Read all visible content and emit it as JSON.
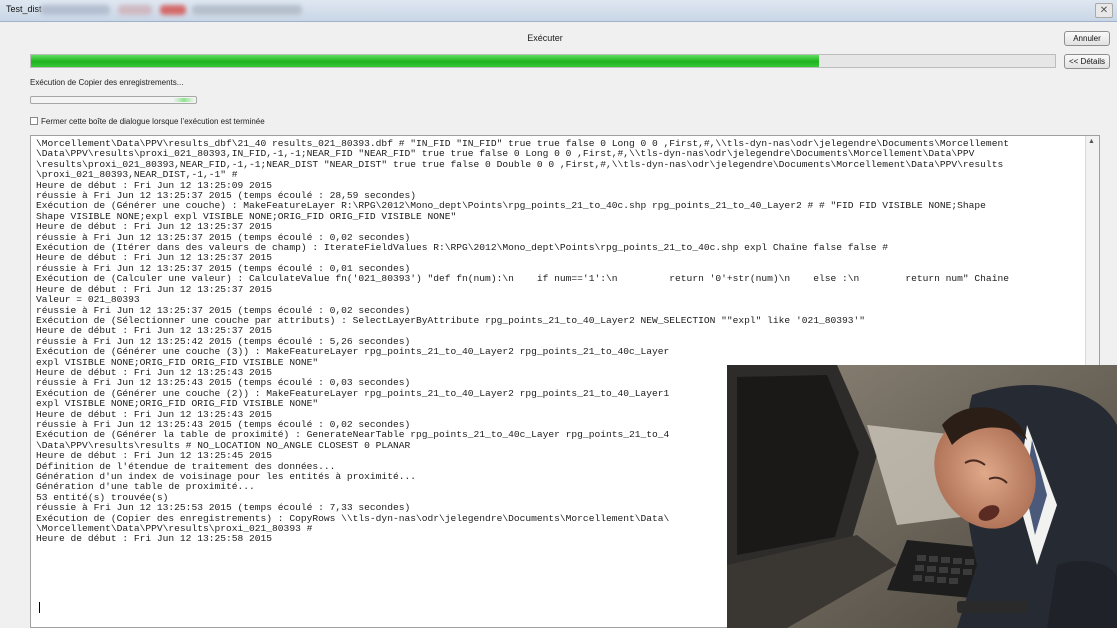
{
  "window": {
    "title": "Test_dist",
    "close_glyph": "✕"
  },
  "dialog": {
    "header": "Exécuter",
    "cancel_label": "Annuler",
    "details_label": "<< Détails",
    "progress_percent": 77,
    "step_label": "Exécution de Copier des enregistrements...",
    "close_option_label": "Fermer cette boîte de dialogue lorsque l’exécution est terminée",
    "close_option_checked": false
  },
  "log": {
    "lines": [
      "\\Morcellement\\Data\\PPV\\results_dbf\\21_40 results_021_80393.dbf # \"IN_FID \"IN_FID\" true true false 0 Long 0 0 ,First,#,\\\\tls-dyn-nas\\odr\\jelegendre\\Documents\\Morcellement",
      "\\Data\\PPV\\results\\proxi_021_80393,IN_FID,-1,-1;NEAR_FID \"NEAR_FID\" true true false 0 Long 0 0 ,First,#,\\\\tls-dyn-nas\\odr\\jelegendre\\Documents\\Morcellement\\Data\\PPV",
      "\\results\\proxi_021_80393,NEAR_FID,-1,-1;NEAR_DIST \"NEAR_DIST\" true true false 0 Double 0 0 ,First,#,\\\\tls-dyn-nas\\odr\\jelegendre\\Documents\\Morcellement\\Data\\PPV\\results",
      "\\proxi_021_80393,NEAR_DIST,-1,-1\" #",
      "Heure de début : Fri Jun 12 13:25:09 2015",
      "réussie à Fri Jun 12 13:25:37 2015 (temps écoulé : 28,59 secondes)",
      "Exécution de (Générer une couche) : MakeFeatureLayer R:\\RPG\\2012\\Mono_dept\\Points\\rpg_points_21_to_40c.shp rpg_points_21_to_40_Layer2 # # \"FID FID VISIBLE NONE;Shape",
      "Shape VISIBLE NONE;expl expl VISIBLE NONE;ORIG_FID ORIG_FID VISIBLE NONE\"",
      "Heure de début : Fri Jun 12 13:25:37 2015",
      "réussie à Fri Jun 12 13:25:37 2015 (temps écoulé : 0,02 secondes)",
      "Exécution de (Itérer dans des valeurs de champ) : IterateFieldValues R:\\RPG\\2012\\Mono_dept\\Points\\rpg_points_21_to_40c.shp expl Chaîne false false #",
      "Heure de début : Fri Jun 12 13:25:37 2015",
      "réussie à Fri Jun 12 13:25:37 2015 (temps écoulé : 0,01 secondes)",
      "Exécution de (Calculer une valeur) : CalculateValue fn('021_80393') \"def fn(num):\\n    if num=='1':\\n         return '0'+str(num)\\n    else :\\n        return num\" Chaîne",
      "Heure de début : Fri Jun 12 13:25:37 2015",
      "Valeur = 021_80393",
      "réussie à Fri Jun 12 13:25:37 2015 (temps écoulé : 0,02 secondes)",
      "Exécution de (Sélectionner une couche par attributs) : SelectLayerByAttribute rpg_points_21_to_40_Layer2 NEW_SELECTION \"\"expl\" like '021_80393'\"",
      "Heure de début : Fri Jun 12 13:25:37 2015",
      "réussie à Fri Jun 12 13:25:42 2015 (temps écoulé : 5,26 secondes)",
      "Exécution de (Générer une couche (3)) : MakeFeatureLayer rpg_points_21_to_40_Layer2 rpg_points_21_to_40c_Layer",
      "expl VISIBLE NONE;ORIG_FID ORIG_FID VISIBLE NONE\"",
      "Heure de début : Fri Jun 12 13:25:43 2015",
      "réussie à Fri Jun 12 13:25:43 2015 (temps écoulé : 0,03 secondes)",
      "Exécution de (Générer une couche (2)) : MakeFeatureLayer rpg_points_21_to_40_Layer2 rpg_points_21_to_40_Layer1",
      "expl VISIBLE NONE;ORIG_FID ORIG_FID VISIBLE NONE\"",
      "Heure de début : Fri Jun 12 13:25:43 2015",
      "réussie à Fri Jun 12 13:25:43 2015 (temps écoulé : 0,02 secondes)",
      "Exécution de (Générer la table de proximité) : GenerateNearTable rpg_points_21_to_40c_Layer rpg_points_21_to_4",
      "\\Data\\PPV\\results\\results # NO_LOCATION NO_ANGLE CLOSEST 0 PLANAR",
      "Heure de début : Fri Jun 12 13:25:45 2015",
      "Définition de l'étendue de traitement des données...",
      "Génération d'un index de voisinage pour les entités à proximité...",
      "Génération d'une table de proximité...",
      "53 entité(s) trouvée(s)",
      "réussie à Fri Jun 12 13:25:53 2015 (temps écoulé : 7,33 secondes)",
      "Exécution de (Copier des enregistrements) : CopyRows \\\\tls-dyn-nas\\odr\\jelegendre\\Documents\\Morcellement\\Data\\",
      "\\Morcellement\\Data\\PPV\\results\\proxi_021_80393 #",
      "Heure de début : Fri Jun 12 13:25:58 2015"
    ]
  },
  "colors": {
    "progress_green": "#1fb21f",
    "window_frame": "#c9d6e6",
    "dialog_bg": "#f0f0f0"
  },
  "photo": {
    "subject": "man asleep face-down on keyboard at desk"
  }
}
